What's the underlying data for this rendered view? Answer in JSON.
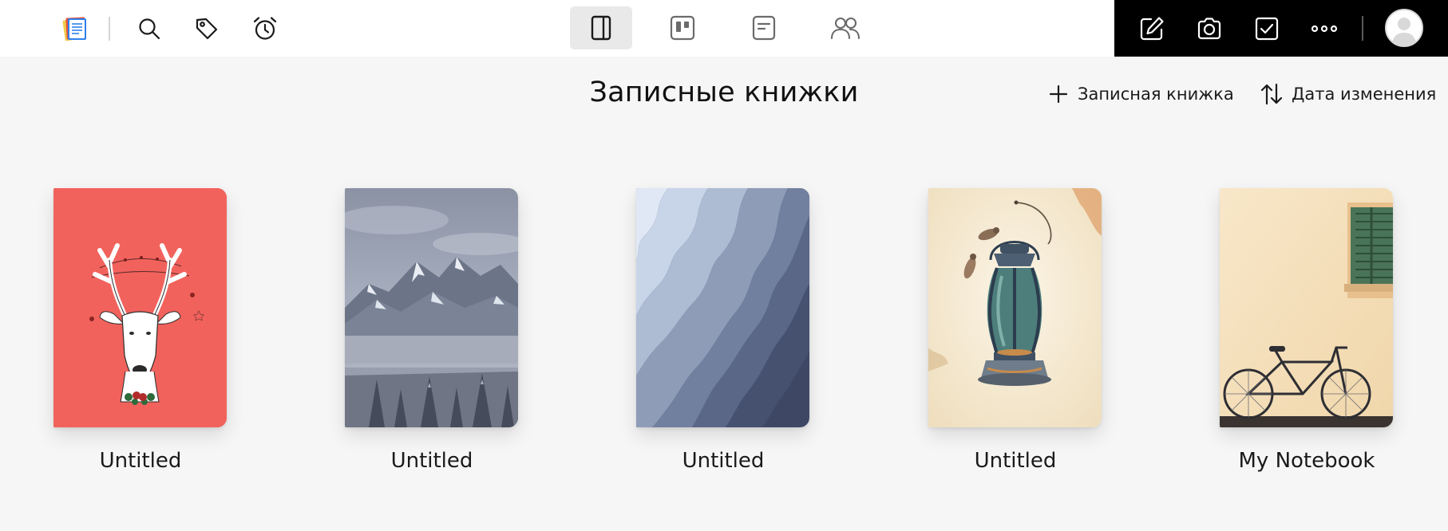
{
  "toolbar": {
    "left": [
      {
        "name": "notebooks-logo-icon"
      },
      {
        "name": "search-icon"
      },
      {
        "name": "tag-icon"
      },
      {
        "name": "reminder-alarm-icon"
      }
    ],
    "views": [
      {
        "name": "notebook-view-icon",
        "active": true
      },
      {
        "name": "board-view-icon",
        "active": false
      },
      {
        "name": "card-view-icon",
        "active": false
      },
      {
        "name": "shared-users-icon",
        "active": false
      }
    ],
    "right": [
      {
        "name": "new-note-pencil-icon"
      },
      {
        "name": "camera-icon"
      },
      {
        "name": "checklist-icon"
      },
      {
        "name": "more-options-icon"
      },
      {
        "name": "user-avatar"
      }
    ]
  },
  "header": {
    "title": "Записные книжки",
    "add_notebook_label": "Записная книжка",
    "sort_label": "Дата изменения"
  },
  "notebooks": [
    {
      "title": "Untitled",
      "cover": "deer",
      "cover_color": "#f2625c"
    },
    {
      "title": "Untitled",
      "cover": "mountains",
      "cover_color": "#8e95a6"
    },
    {
      "title": "Untitled",
      "cover": "waves",
      "cover_color": "#5f6a85"
    },
    {
      "title": "Untitled",
      "cover": "lantern",
      "cover_color": "#f3e7cf"
    },
    {
      "title": "My Notebook",
      "cover": "bicycle",
      "cover_color": "#f3dcb7"
    }
  ],
  "colors": {
    "accent_dark_bar": "#000000",
    "background": "#f6f6f6"
  }
}
